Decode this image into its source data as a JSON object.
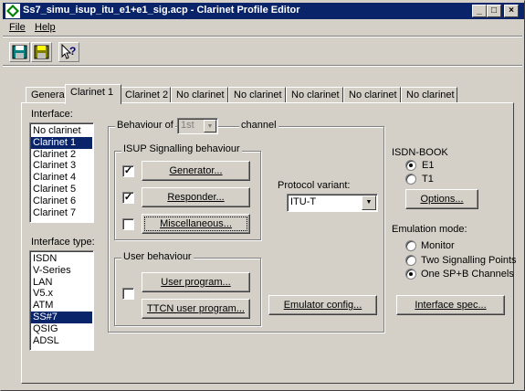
{
  "window": {
    "title": "Ss7_simu_isup_itu_e1+e1_sig.acp - Clarinet Profile Editor",
    "minimize_glyph": "_",
    "maximize_glyph": "□",
    "close_glyph": "×"
  },
  "menu": {
    "file": "File",
    "help": "Help"
  },
  "toolbar": {
    "icons": [
      "save-icon",
      "save-as-icon",
      "context-help-icon"
    ]
  },
  "tabs": [
    {
      "label": "General"
    },
    {
      "label": "Clarinet 1",
      "active": true
    },
    {
      "label": "Clarinet 2"
    },
    {
      "label": "No clarinet"
    },
    {
      "label": "No clarinet"
    },
    {
      "label": "No clarinet"
    },
    {
      "label": "No clarinet"
    },
    {
      "label": "No clarinet"
    }
  ],
  "interface": {
    "label": "Interface:",
    "items": [
      "No clarinet",
      "Clarinet 1",
      "Clarinet 2",
      "Clarinet 3",
      "Clarinet 4",
      "Clarinet 5",
      "Clarinet 6",
      "Clarinet 7"
    ],
    "selected": "Clarinet 1"
  },
  "interface_type": {
    "label": "Interface type:",
    "items": [
      "ISDN",
      "V-Series",
      "LAN",
      "V5.x",
      "ATM",
      "SS#7",
      "QSIG",
      "ADSL"
    ],
    "selected": "SS#7"
  },
  "behaviour": {
    "label_prefix": "Behaviour of",
    "channel_value": "1st",
    "label_suffix": "channel"
  },
  "isup": {
    "label": "ISUP Signalling behaviour",
    "rows": [
      {
        "button": "Generator...",
        "checked": true,
        "check_glyph": "✓"
      },
      {
        "button": "Responder...",
        "checked": true,
        "check_glyph": "✓"
      },
      {
        "button": "Miscellaneous...",
        "checked": false,
        "check_glyph": ""
      }
    ]
  },
  "protocol": {
    "label": "Protocol variant:",
    "value": "ITU-T"
  },
  "user_behaviour": {
    "label": "User behaviour",
    "user_program": "User program...",
    "ttcn_program": "TTCN user program...",
    "checked": false
  },
  "emulator_config": "Emulator config...",
  "isdn_book": {
    "label": "ISDN-BOOK",
    "options": [
      "E1",
      "T1"
    ],
    "selected": "E1",
    "options_button": "Options..."
  },
  "emulation_mode": {
    "label": "Emulation mode:",
    "options": [
      "Monitor",
      "Two Signalling Points",
      "One SP+B Channels"
    ],
    "selected": "One SP+B Channels"
  },
  "interface_spec": "Interface spec...",
  "colors": {
    "titlebar": "#0a246a",
    "face": "#d4d0c8",
    "selection": "#0a246a"
  }
}
